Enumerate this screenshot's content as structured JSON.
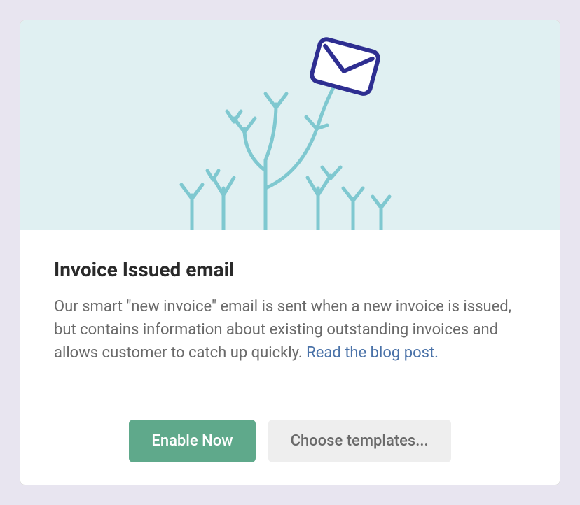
{
  "card": {
    "title": "Invoice Issued email",
    "description": "Our smart \"new invoice\" email is sent when a new invoice is issued, but contains information about existing outstanding invoices and allows customer to catch up quickly. ",
    "link_label": "Read the blog post.",
    "actions": {
      "primary_label": "Enable Now",
      "secondary_label": "Choose templates..."
    }
  }
}
